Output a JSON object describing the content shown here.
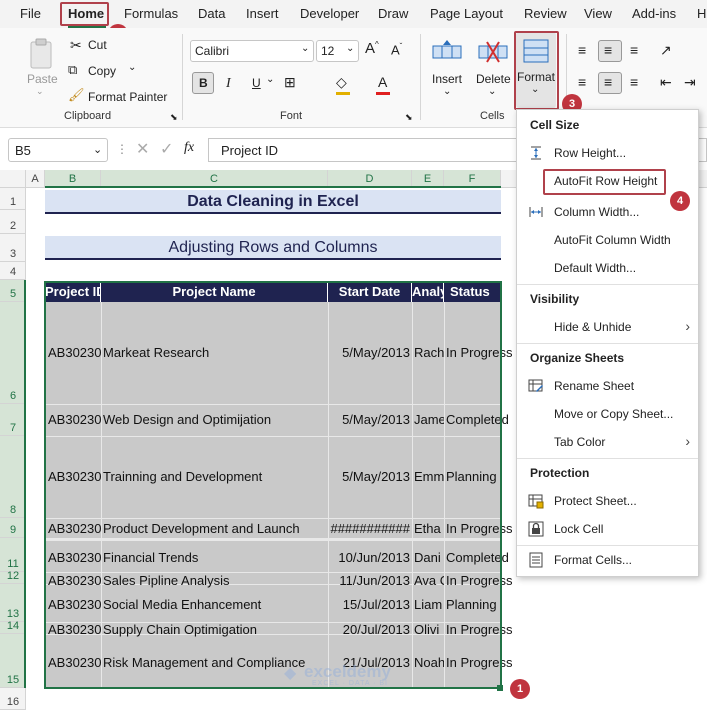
{
  "menu": {
    "tabs": [
      "File",
      "Home",
      "Formulas",
      "Data",
      "Insert",
      "Developer",
      "Draw",
      "Page Layout",
      "Review",
      "View",
      "Add-ins",
      "H"
    ]
  },
  "ribbon": {
    "clipboard": {
      "paste": "Paste",
      "cut": "Cut",
      "copy": "Copy",
      "format_painter": "Format Painter",
      "label": "Clipboard"
    },
    "font": {
      "name": "Calibri",
      "size": "12",
      "label": "Font",
      "bold": "B",
      "italic": "I",
      "underline": "U"
    },
    "cells": {
      "insert": "Insert",
      "delete": "Delete",
      "format": "Format",
      "label": "Cells"
    }
  },
  "formula_bar": {
    "name_box": "B5",
    "fx": "fx",
    "value": "Project ID"
  },
  "sheet": {
    "columns": [
      "A",
      "B",
      "C",
      "D",
      "E",
      "F"
    ],
    "rows": [
      "1",
      "2",
      "3",
      "4",
      "5",
      "6",
      "7",
      "8",
      "9",
      "11",
      "12",
      "13",
      "14",
      "15",
      "16"
    ],
    "title": "Data Cleaning in Excel",
    "subtitle": "Adjusting Rows and Columns",
    "headers": [
      "Project ID",
      "Project Name",
      "Start Date",
      "Analyst",
      "Status"
    ],
    "data": [
      [
        "AB30230",
        "Markeat Research",
        "5/May/2013",
        "Rach",
        "In Progress"
      ],
      [
        "AB30230",
        "Web Design and Optimijation",
        "5/May/2013",
        "Jame",
        "Completed"
      ],
      [
        "AB30230",
        "Trainning and Development",
        "5/May/2013",
        "Emm",
        "Planning"
      ],
      [
        "AB30230",
        "Product Development and Launch",
        "###########",
        "Etha",
        "In Progress"
      ],
      [
        "AB30230",
        "Financial Trends",
        "10/Jun/2013",
        "Dani",
        "Completed"
      ],
      [
        "AB30230",
        "Sales Pipline Analysis",
        "11/Jun/2013",
        "Ava C",
        "In Progress"
      ],
      [
        "AB30230",
        "Social Media Enhancement",
        "15/Jul/2013",
        "Liam",
        "Planning"
      ],
      [
        "AB30230",
        "Supply Chain Optimigation",
        "20/Jul/2013",
        "Olivi",
        "In Progress"
      ],
      [
        "AB30230",
        "Risk Management and Compliance",
        "21/Jul/2013",
        "Noah",
        "In Progress"
      ]
    ]
  },
  "dropdown": {
    "cell_size": "Cell Size",
    "row_height": "Row Height...",
    "autofit_row": "AutoFit Row Height",
    "column_width": "Column Width...",
    "autofit_col": "AutoFit Column Width",
    "default_width": "Default Width...",
    "visibility": "Visibility",
    "hide_unhide": "Hide & Unhide",
    "organize": "Organize Sheets",
    "rename": "Rename Sheet",
    "move_copy": "Move or Copy Sheet...",
    "tab_color": "Tab Color",
    "protection": "Protection",
    "protect_sheet": "Protect Sheet...",
    "lock_cell": "Lock Cell",
    "format_cells": "Format Cells..."
  },
  "badges": [
    "1",
    "2",
    "3",
    "4"
  ],
  "watermark": {
    "name": "exceldemy",
    "tagline": "EXCEL · DATA · BI"
  },
  "colors": {
    "accent_green": "#217346",
    "header_navy": "#1f2350",
    "highlight": "#b0414b",
    "title_band": "#dae3f3"
  }
}
